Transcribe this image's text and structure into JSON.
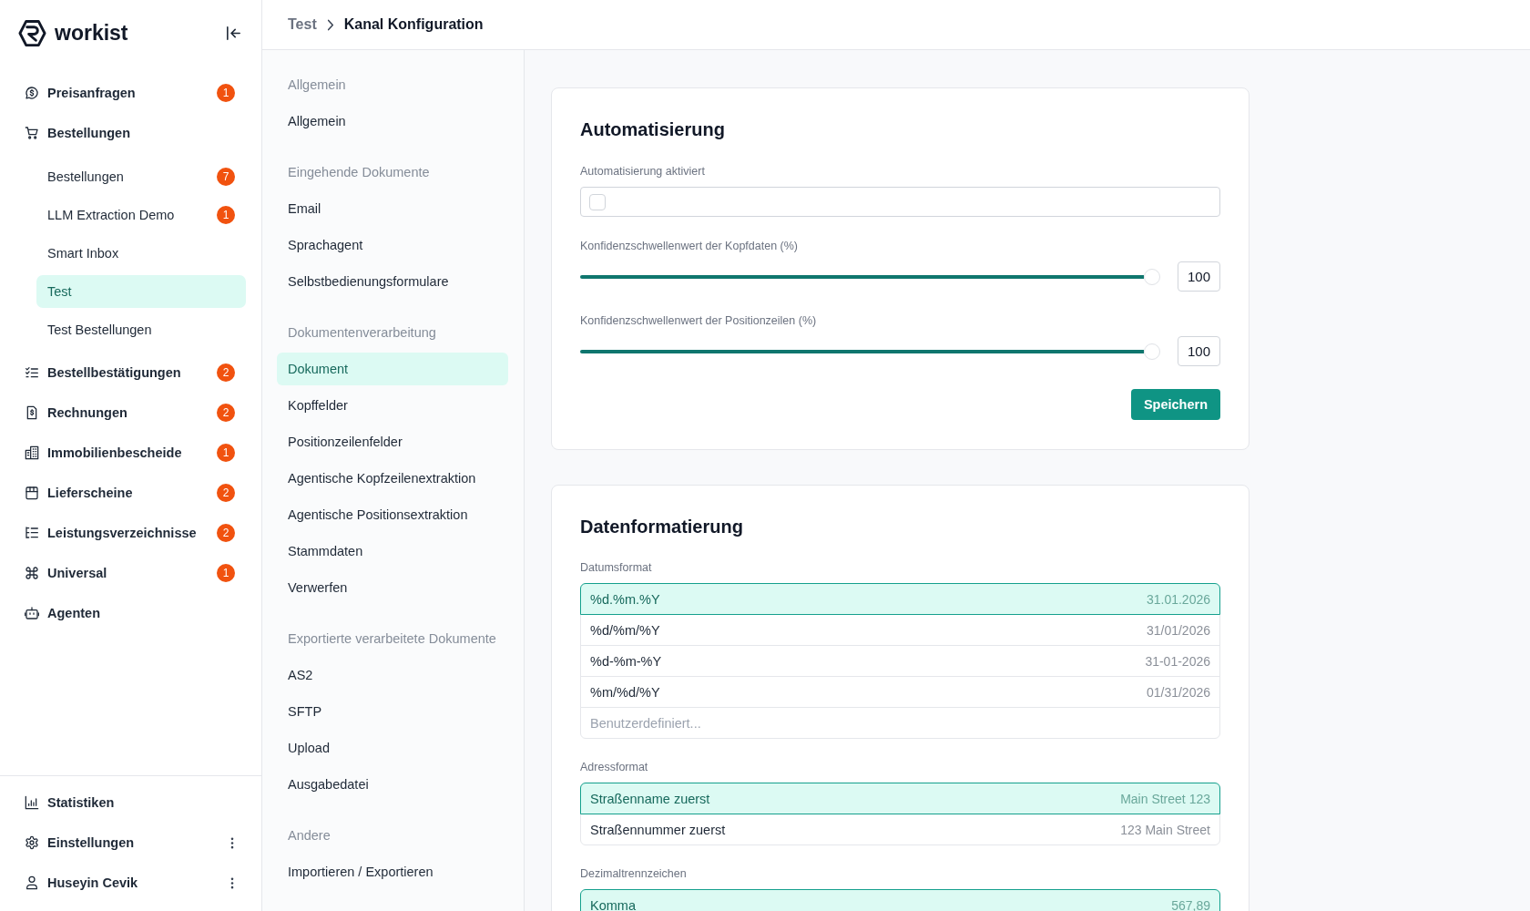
{
  "sidebar": {
    "logo": "workist",
    "items": [
      {
        "label": "Preisanfragen",
        "badge": "1",
        "selected": false
      },
      {
        "label": "Bestellungen",
        "selected": false,
        "children": [
          {
            "label": "Bestellungen",
            "badge": "7",
            "selected": false
          },
          {
            "label": "LLM Extraction Demo",
            "badge": "1",
            "selected": false
          },
          {
            "label": "Smart Inbox",
            "selected": false
          },
          {
            "label": "Test",
            "selected": true
          },
          {
            "label": "Test Bestellungen",
            "selected": false
          }
        ]
      },
      {
        "label": "Bestellbestätigungen",
        "badge": "2",
        "selected": false
      },
      {
        "label": "Rechnungen",
        "badge": "2",
        "selected": false
      },
      {
        "label": "Immobilienbescheide",
        "badge": "1",
        "selected": false
      },
      {
        "label": "Lieferscheine",
        "badge": "2",
        "selected": false
      },
      {
        "label": "Leistungsverzeichnisse",
        "badge": "2",
        "selected": false
      },
      {
        "label": "Universal",
        "badge": "1",
        "selected": false
      },
      {
        "label": "Agenten",
        "selected": false
      }
    ],
    "footer_items": [
      {
        "label": "Statistiken",
        "selected": false
      },
      {
        "label": "Einstellungen",
        "menu": true,
        "selected": false
      },
      {
        "label": "Huseyin Cevik",
        "menu": true,
        "selected": false
      }
    ]
  },
  "breadcrumb": [
    {
      "label": "Test"
    },
    {
      "label": "Kanal Konfiguration"
    }
  ],
  "settings_nav": {
    "sections": [
      {
        "heading": "Allgemein",
        "items": [
          {
            "label": "Allgemein",
            "selected": false
          }
        ]
      },
      {
        "heading": "Eingehende Dokumente",
        "items": [
          {
            "label": "Email",
            "selected": false
          },
          {
            "label": "Sprachagent",
            "selected": false
          },
          {
            "label": "Selbstbedienungsformulare",
            "selected": false
          }
        ]
      },
      {
        "heading": "Dokumentenverarbeitung",
        "items": [
          {
            "label": "Dokument",
            "selected": true
          },
          {
            "label": "Kopffelder",
            "selected": false
          },
          {
            "label": "Positionzeilenfelder",
            "selected": false
          },
          {
            "label": "Agentische Kopfzeilenextraktion",
            "selected": false
          },
          {
            "label": "Agentische Positionsextraktion",
            "selected": false
          },
          {
            "label": "Stammdaten",
            "selected": false
          },
          {
            "label": "Verwerfen",
            "selected": false
          }
        ]
      },
      {
        "heading": "Exportierte verarbeitete Dokumente",
        "items": [
          {
            "label": "AS2",
            "selected": false
          },
          {
            "label": "SFTP",
            "selected": false
          },
          {
            "label": "Upload",
            "selected": false
          },
          {
            "label": "Ausgabedatei",
            "selected": false
          }
        ]
      },
      {
        "heading": "Andere",
        "items": [
          {
            "label": "Importieren / Exportieren",
            "selected": false
          }
        ]
      }
    ]
  },
  "automation": {
    "title": "Automatisierung",
    "fields": [
      {
        "kind": "checkbox",
        "label": "Automatisierung aktiviert",
        "checked": false
      },
      {
        "kind": "slider",
        "label": "Konfidenzschwellenwert der Kopfdaten (%)",
        "level": 1,
        "value": "100"
      },
      {
        "kind": "slider",
        "label": "Konfidenzschwellenwert der Positionzeilen (%)",
        "level": 1,
        "value": "100"
      }
    ],
    "save_button": "Speichern"
  },
  "formatting": {
    "title": "Datenformatierung",
    "groups": [
      {
        "label": "Datumsformat",
        "options": [
          {
            "label": "%d.%m.%Y",
            "example": "31.01.2026",
            "selected": true
          },
          {
            "label": "%d/%m/%Y",
            "example": "31/01/2026",
            "selected": false
          },
          {
            "label": "%d-%m-%Y",
            "example": "31-01-2026",
            "selected": false
          },
          {
            "label": "%m/%d/%Y",
            "example": "01/31/2026",
            "selected": false
          }
        ],
        "custom_placeholder": "Benutzerdefiniert..."
      },
      {
        "label": "Adressformat",
        "options": [
          {
            "label": "Straßenname zuerst",
            "example": "Main Street 123",
            "selected": true
          },
          {
            "label": "Straßennummer zuerst",
            "example": "123 Main Street",
            "selected": false
          }
        ]
      },
      {
        "label": "Dezimaltrennzeichen",
        "options": [
          {
            "label": "Komma",
            "example": "567,89",
            "selected": true
          }
        ]
      }
    ]
  }
}
